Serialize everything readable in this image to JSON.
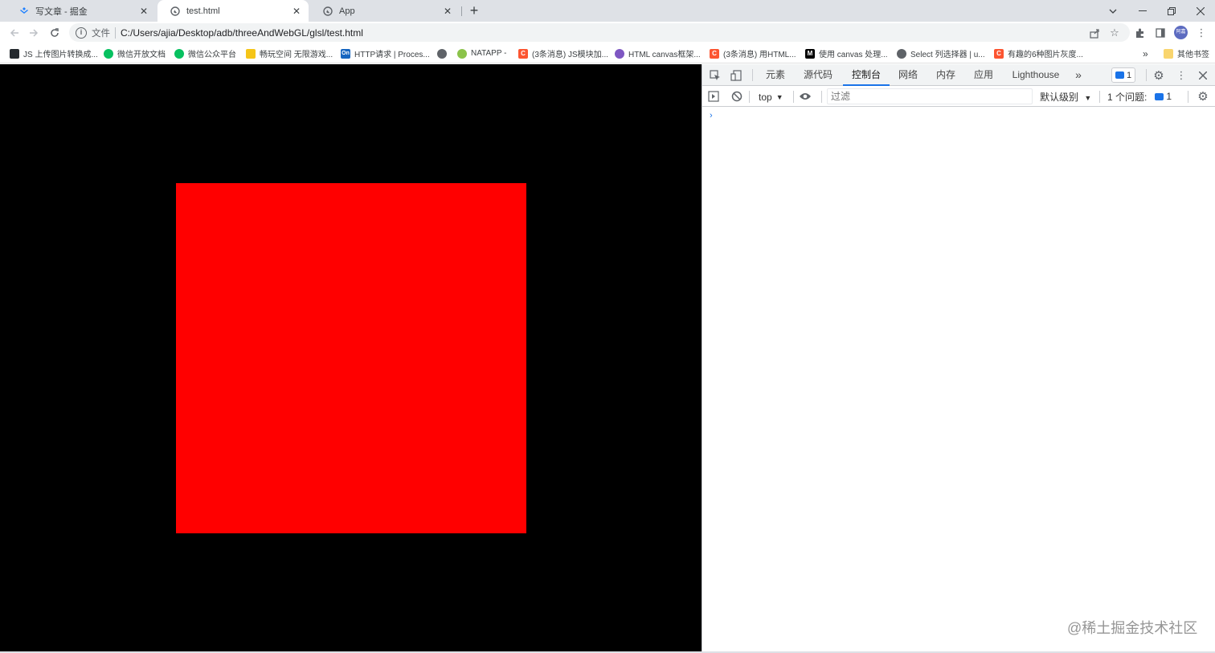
{
  "tabs": [
    {
      "title": "写文章 - 掘金",
      "icon": "juejin-icon"
    },
    {
      "title": "test.html",
      "icon": "globe-icon",
      "active": true
    },
    {
      "title": "App",
      "icon": "globe-icon"
    }
  ],
  "toolbar": {
    "scheme_label": "文件",
    "url": "C:/Users/ajia/Desktop/adb/threeAndWebGL/glsl/test.html",
    "avatar_text": "阿嘉"
  },
  "bookmarks": [
    {
      "label": "JS 上传图片转换成...",
      "icon": "github-icon",
      "color": "#24292e"
    },
    {
      "label": "微信开放文档",
      "icon": "wechat-icon",
      "color": "#07c160"
    },
    {
      "label": "微信公众平台",
      "icon": "wechat-icon",
      "color": "#07c160"
    },
    {
      "label": "畅玩空间 无限游戏...",
      "icon": "game-icon",
      "color": "#f5c518"
    },
    {
      "label": "HTTP请求 | Proces...",
      "icon": "on-icon",
      "color": "#1565c0"
    },
    {
      "label": "",
      "icon": "globe-icon",
      "color": "#5f6368"
    },
    {
      "label": "NATAPP -",
      "icon": "natapp-icon",
      "color": "#8bc34a"
    },
    {
      "label": "(3条消息) JS模块加...",
      "icon": "csdn-icon",
      "color": "#fc5531"
    },
    {
      "label": "HTML canvas框架...",
      "icon": "canvas-icon",
      "color": "#7e57c2"
    },
    {
      "label": "(3条消息) 用HTML...",
      "icon": "csdn-icon",
      "color": "#fc5531"
    },
    {
      "label": "使用 canvas 处理...",
      "icon": "mdn-icon",
      "color": "#000000"
    },
    {
      "label": "Select 列选择器 | u...",
      "icon": "globe-icon",
      "color": "#5f6368"
    },
    {
      "label": "有趣的6种图片灰度...",
      "icon": "csdn-icon",
      "color": "#fc5531"
    }
  ],
  "bookmarks_overflow": "»",
  "other_bookmarks": "其他书签",
  "page": {
    "background": "#000000",
    "square_color": "#ff0000"
  },
  "devtools": {
    "tabs": [
      "元素",
      "源代码",
      "控制台",
      "网络",
      "内存",
      "应用",
      "Lighthouse"
    ],
    "active_tab": "控制台",
    "more_tabs": "»",
    "issue_count": "1",
    "context": "top",
    "filter_placeholder": "过滤",
    "level": "默认级别",
    "issues_label": "1 个问题:",
    "issues_count": "1",
    "prompt": "›"
  },
  "watermark": "@稀土掘金技术社区"
}
